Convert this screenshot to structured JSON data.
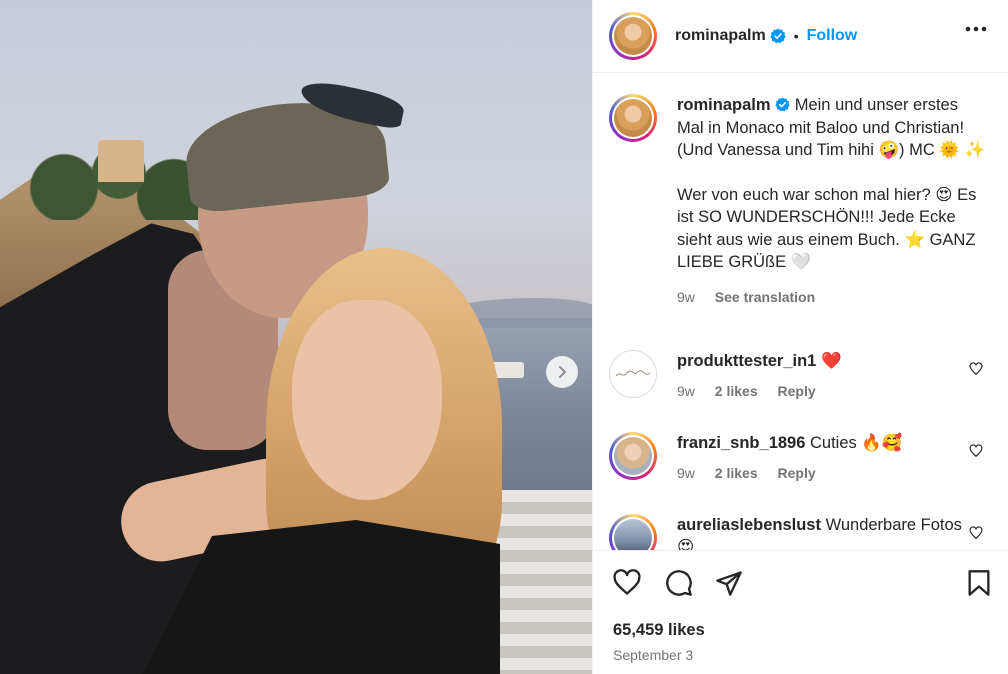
{
  "post": {
    "username": "rominapalm",
    "follow_label": "Follow",
    "dot": "•",
    "caption": {
      "username": "rominapalm",
      "text_1": "Mein und unser erstes Mal in Monaco mit Baloo und Christian! (Und Vanessa und Tim hihi 🤪) MC 🌞 ✨",
      "text_2": "Wer von euch war schon mal hier? 😍 Es ist SO WUNDERSCHÖN!!! Jede Ecke sieht aus wie aus einem Buch. ⭐ GANZ LIEBE GRÜßE 🤍",
      "age": "9w",
      "see_translation": "See translation"
    },
    "comments": [
      {
        "username": "produkttester_in1",
        "text": "❤️",
        "age": "9w",
        "likes": "2 likes",
        "reply": "Reply"
      },
      {
        "username": "franzi_snb_1896",
        "text": "Cuties 🔥🥰",
        "age": "9w",
        "likes": "2 likes",
        "reply": "Reply"
      },
      {
        "username": "aureliaslebenslust",
        "text": "Wunderbare Fotos 😍",
        "age": "",
        "likes": "",
        "reply": ""
      }
    ],
    "likes_count": "65,459 likes",
    "date": "September 3"
  },
  "icons": {
    "more": "more-options-icon",
    "verified": "verified-badge-icon",
    "next": "chevron-right-icon",
    "like": "heart-icon",
    "comment": "comment-icon",
    "share": "share-icon",
    "save": "bookmark-icon"
  },
  "colors": {
    "accent": "#0095f6",
    "heart": "#ed4956",
    "muted": "#737373"
  }
}
